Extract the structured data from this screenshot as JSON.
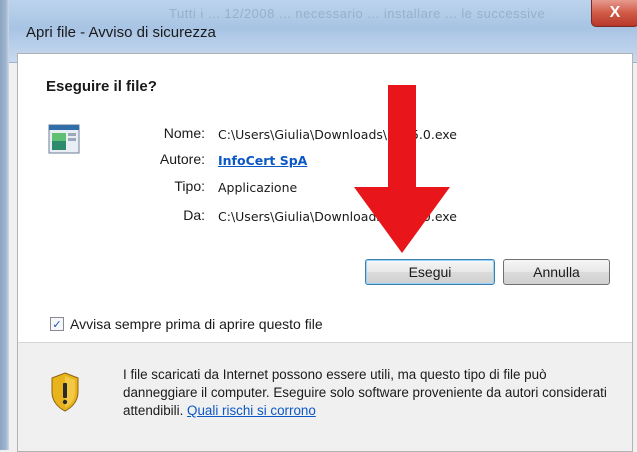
{
  "window": {
    "title": "Apri file - Avviso di sicurezza",
    "background_hint": "Tutti i ... 12/2008 ... necessario ... installare ... le successive",
    "close_glyph": "X"
  },
  "dialog": {
    "question": "Eseguire il file?",
    "fields": [
      {
        "label": "Nome:",
        "value": "C:\\Users\\Giulia\\Downloads\\...5.5.0.exe"
      },
      {
        "label": "Autore:",
        "value": "InfoCert SpA"
      },
      {
        "label": "Tipo:",
        "value": "Applicazione"
      },
      {
        "label": "Da:",
        "value": "C:\\Users\\Giulia\\Downloads\\...5.5.0.exe"
      }
    ],
    "buttons": {
      "run": "Esegui",
      "cancel": "Annulla"
    },
    "checkbox": {
      "checked": true,
      "label": "Avvisa sempre prima di aprire questo file"
    },
    "warning": {
      "text": "I file scaricati da Internet possono essere utili, ma questo tipo di file può danneggiare il computer. Eseguire solo software proveniente da autori considerati attendibili.",
      "link": "Quali rischi si corrono"
    }
  },
  "colors": {
    "accent_link": "#0b57c5",
    "arrow": "#e8161b",
    "close_button": "#c9483a"
  }
}
